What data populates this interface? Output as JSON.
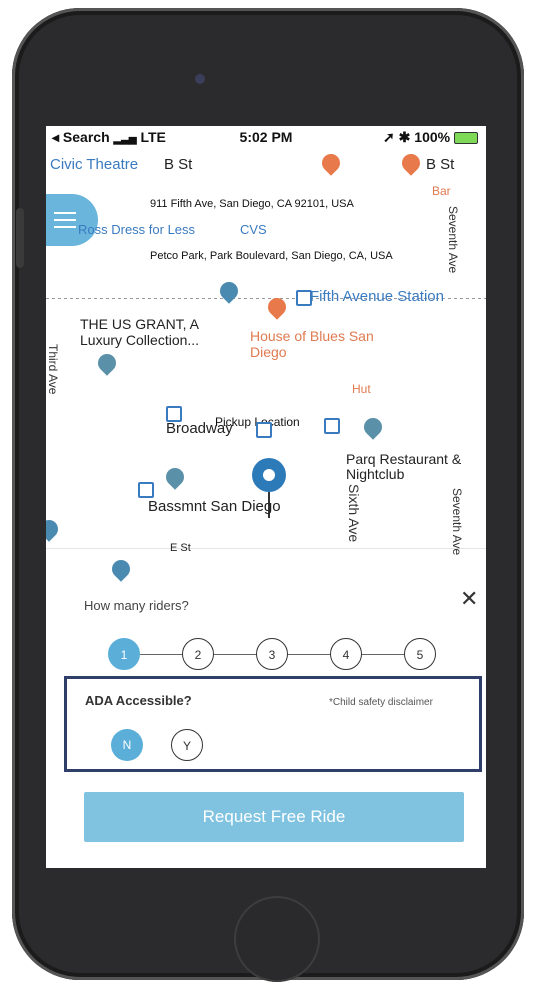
{
  "status_bar": {
    "back_app": "Search",
    "network": "LTE",
    "time": "5:02 PM",
    "battery": "100%"
  },
  "map": {
    "labels": {
      "civic_theatre": "Civic Theatre",
      "b_st_1": "B St",
      "b_st_2": "B St",
      "bar": "Bar",
      "ross": "Ross Dress for Less",
      "cvs": "CVS",
      "fifth_station": "Fifth Avenue Station",
      "us_grant": "THE US GRANT, A Luxury Collection...",
      "house_of_blues": "House of Blues San Diego",
      "hut": "Hut",
      "broadway": "Broadway",
      "parq": "Parq Restaurant & Nightclub",
      "bassmnt": "Bassmnt San Diego",
      "e_st": "E St",
      "sixth_ave": "Sixth Ave",
      "seventh_ave_top": "Seventh Ave",
      "seventh_ave_bottom": "Seventh Ave",
      "third_ave": "Third Ave"
    },
    "addresses": {
      "destination": "911 Fifth Ave, San Diego, CA 92101, USA",
      "origin": "Petco Park, Park Boulevard, San Diego, CA, USA"
    },
    "pickup_label": "Pickup Location"
  },
  "riders": {
    "question": "How many riders?",
    "options": [
      "1",
      "2",
      "3",
      "4",
      "5"
    ],
    "selected": "1"
  },
  "ada": {
    "question": "ADA Accessible?",
    "disclaimer": "*Child safety disclaimer",
    "no": "N",
    "yes": "Y"
  },
  "request_button": "Request Free Ride",
  "colors": {
    "accent": "#5aaed8",
    "button": "#7fc3e0",
    "ada_border": "#2f3f6a"
  }
}
